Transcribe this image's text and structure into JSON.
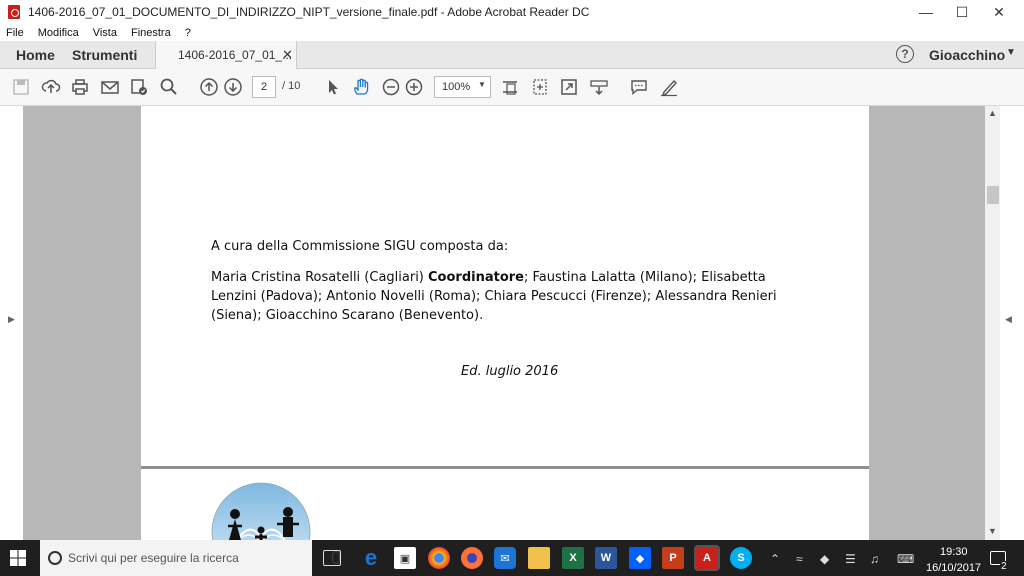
{
  "window": {
    "title": "1406-2016_07_01_DOCUMENTO_DI_INDIRIZZO_NIPT_versione_finale.pdf - Adobe Acrobat Reader DC"
  },
  "menu": [
    "File",
    "Modifica",
    "Vista",
    "Finestra",
    "?"
  ],
  "tabs": {
    "home": "Home",
    "tools": "Strumenti",
    "document": "1406-2016_07_01_..."
  },
  "user": {
    "name": "Gioacchino"
  },
  "toolbar": {
    "page_current": "2",
    "page_total": "/ 10",
    "zoom": "100%"
  },
  "document": {
    "intro": "A cura della Commissione SIGU composta da:",
    "author_1": "Maria Cristina Rosatelli   (Cagliari) ",
    "coordinator": "Coordinatore",
    "authors_rest": "; Faustina Lalatta    (Milano); Elisabetta Lenzini (Padova); Antonio Novelli    (Roma); Chiara Pescucci    (Firenze); Alessandra Renieri  (Siena); Gioacchino Scarano  (Benevento).",
    "edition": "Ed. luglio 2016"
  },
  "taskbar": {
    "search_placeholder": "Scrivi qui per eseguire la ricerca",
    "time": "19:30",
    "date": "16/10/2017",
    "notifications": "2"
  },
  "colors": {
    "acrobat_red": "#c8211b",
    "edge_blue": "#1e74d4",
    "excel_green": "#1e7145",
    "word_blue": "#2b579a",
    "dropbox_blue": "#0061fe",
    "powerpoint_red": "#c43e1c",
    "skype_blue": "#00aff0"
  }
}
